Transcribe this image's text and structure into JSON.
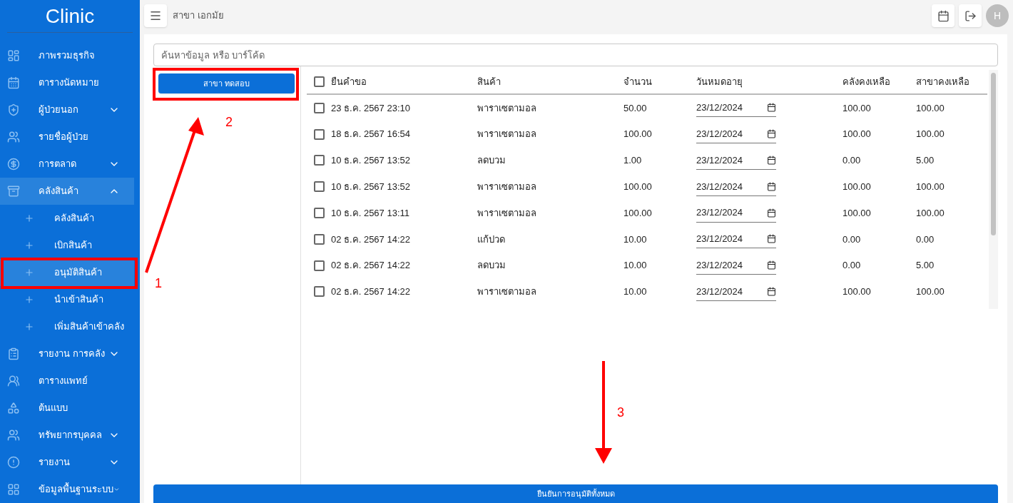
{
  "sidebar": {
    "brand": "Clinic",
    "items": [
      {
        "label": "ภาพรวมธุรกิจ",
        "kind": "link"
      },
      {
        "label": "ตารางนัดหมาย",
        "kind": "link"
      },
      {
        "label": "ผู้ป่วยนอก",
        "kind": "group",
        "expanded": false
      },
      {
        "label": "รายชื่อผู้ป่วย",
        "kind": "link"
      },
      {
        "label": "การตลาด",
        "kind": "group",
        "expanded": false
      },
      {
        "label": "คลังสินค้า",
        "kind": "group",
        "expanded": true,
        "children": [
          {
            "label": "คลังสินค้า",
            "selected": false
          },
          {
            "label": "เบิกสินค้า",
            "selected": false
          },
          {
            "label": "อนุมัติสินค้า",
            "selected": true
          },
          {
            "label": "นำเข้าสินค้า",
            "selected": false
          },
          {
            "label": "เพิ่มสินค้าเข้าคลัง",
            "selected": false
          }
        ]
      },
      {
        "label": "รายงาน การคลัง",
        "kind": "group",
        "expanded": false
      },
      {
        "label": "ตารางแพทย์",
        "kind": "link"
      },
      {
        "label": "ต้นแบบ",
        "kind": "link"
      },
      {
        "label": "ทรัพยากรบุคคล",
        "kind": "group",
        "expanded": false
      },
      {
        "label": "รายงาน",
        "kind": "group",
        "expanded": false
      },
      {
        "label": "ข้อมูลพื้นฐานระบบ",
        "kind": "group",
        "expanded": false
      }
    ]
  },
  "header": {
    "branch": "สาขา เอกมัย",
    "avatar": "H"
  },
  "search": {
    "placeholder": "ค้นหาข้อมูล หรือ บาร์โค้ด"
  },
  "branches": [
    {
      "label": "สาขา ทดสอบ"
    }
  ],
  "table": {
    "columns": [
      "ยืนคำขอ",
      "สินค้า",
      "จำนวน",
      "วันหมดอายุ",
      "คลังคงเหลือ",
      "สาขาคงเหลือ"
    ],
    "all_checked": false,
    "rows": [
      {
        "checked": false,
        "date": "23 ธ.ค. 2567 23:10",
        "product": "พาราเซตามอล",
        "qty": "50.00",
        "expiry": "23/12/2024",
        "stock": "100.00",
        "branch_stock": "100.00"
      },
      {
        "checked": false,
        "date": "18 ธ.ค. 2567 16:54",
        "product": "พาราเซตามอล",
        "qty": "100.00",
        "expiry": "23/12/2024",
        "stock": "100.00",
        "branch_stock": "100.00"
      },
      {
        "checked": false,
        "date": "10 ธ.ค. 2567 13:52",
        "product": "ลดบวม",
        "qty": "1.00",
        "expiry": "23/12/2024",
        "stock": "0.00",
        "branch_stock": "5.00"
      },
      {
        "checked": false,
        "date": "10 ธ.ค. 2567 13:52",
        "product": "พาราเซตามอล",
        "qty": "100.00",
        "expiry": "23/12/2024",
        "stock": "100.00",
        "branch_stock": "100.00"
      },
      {
        "checked": false,
        "date": "10 ธ.ค. 2567 13:11",
        "product": "พาราเซตามอล",
        "qty": "100.00",
        "expiry": "23/12/2024",
        "stock": "100.00",
        "branch_stock": "100.00"
      },
      {
        "checked": false,
        "date": "02 ธ.ค. 2567 14:22",
        "product": "แก้ปวด",
        "qty": "10.00",
        "expiry": "23/12/2024",
        "stock": "0.00",
        "branch_stock": "0.00"
      },
      {
        "checked": false,
        "date": "02 ธ.ค. 2567 14:22",
        "product": "ลดบวม",
        "qty": "10.00",
        "expiry": "23/12/2024",
        "stock": "0.00",
        "branch_stock": "5.00"
      },
      {
        "checked": false,
        "date": "02 ธ.ค. 2567 14:22",
        "product": "พาราเซตามอล",
        "qty": "10.00",
        "expiry": "23/12/2024",
        "stock": "100.00",
        "branch_stock": "100.00"
      }
    ]
  },
  "confirm_button": "ยืนยันการอนุมัติทั้งหมด",
  "annotations": [
    {
      "label": "1"
    },
    {
      "label": "2"
    },
    {
      "label": "3"
    }
  ]
}
